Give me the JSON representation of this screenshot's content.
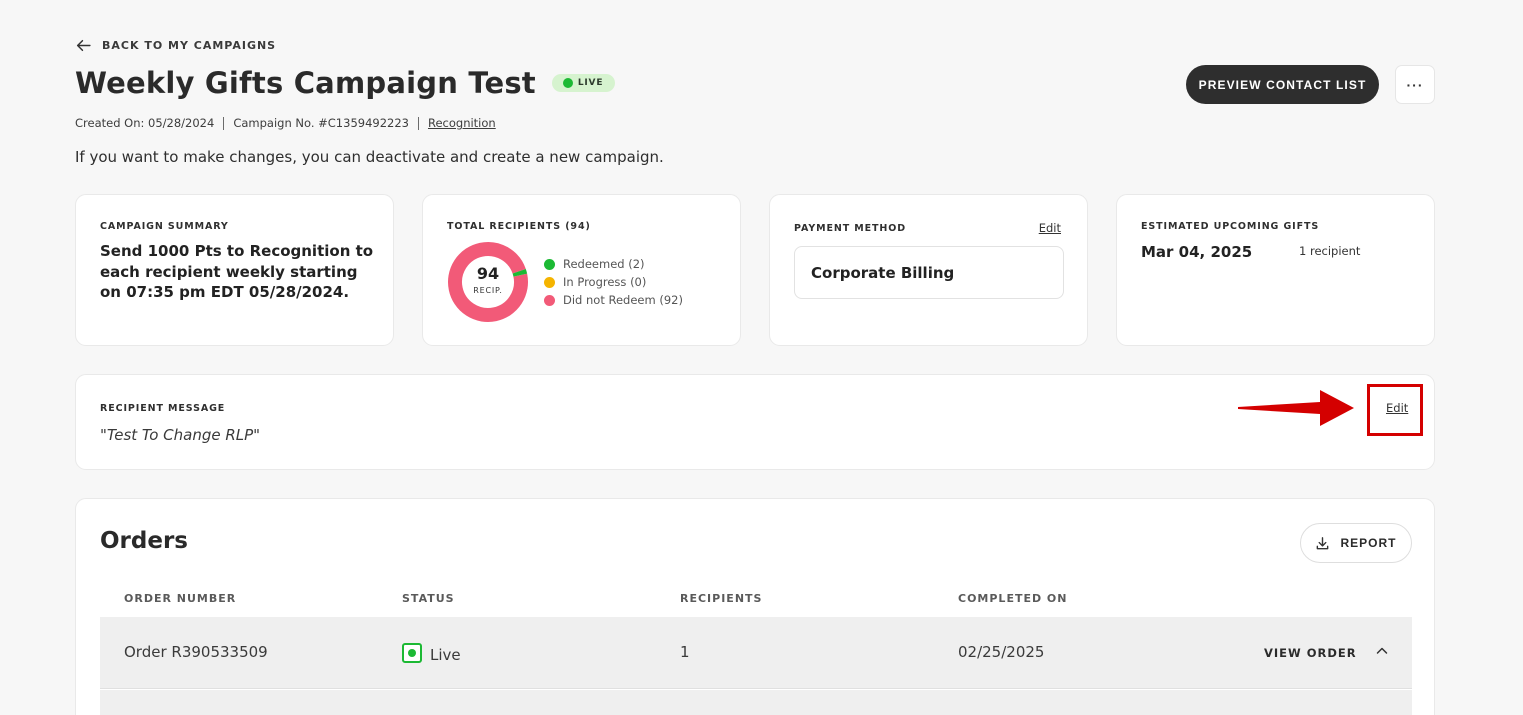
{
  "nav": {
    "back_label": "BACK TO MY CAMPAIGNS"
  },
  "header": {
    "title": "Weekly Gifts Campaign Test",
    "status_badge": "LIVE",
    "preview_button": "PREVIEW CONTACT LIST",
    "more_button": "···",
    "created_on": "Created On: 05/28/2024",
    "campaign_no": "Campaign No. #C1359492223",
    "category": "Recognition",
    "info_text": "If you want to make changes, you can deactivate and create a new campaign."
  },
  "campaign_summary": {
    "label": "CAMPAIGN SUMMARY",
    "text": "Send 1000 Pts to Recognition to each recipient weekly starting on 07:35 pm EDT 05/28/2024."
  },
  "recipients": {
    "label": "TOTAL RECIPIENTS (94)",
    "total": "94",
    "total_sub": "RECIP.",
    "legend": [
      {
        "label": "Redeemed (2)",
        "value": 2,
        "color": "#1cb934"
      },
      {
        "label": "In Progress (0)",
        "value": 0,
        "color": "#f5b400"
      },
      {
        "label": "Did not Redeem (92)",
        "value": 92,
        "color": "#f25a78"
      }
    ]
  },
  "payment": {
    "label": "PAYMENT METHOD",
    "edit_label": "Edit",
    "method": "Corporate Billing"
  },
  "upcoming": {
    "label": "ESTIMATED UPCOMING GIFTS",
    "date": "Mar 04, 2025",
    "count": "1 recipient"
  },
  "message": {
    "label": "RECIPIENT MESSAGE",
    "text": "\"Test To Change RLP\"",
    "edit_label": "Edit"
  },
  "orders": {
    "title": "Orders",
    "report_button": "REPORT",
    "columns": [
      "ORDER NUMBER",
      "STATUS",
      "RECIPIENTS",
      "COMPLETED ON"
    ],
    "rows": [
      {
        "order": "Order R390533509",
        "status": "Live",
        "recipients": "1",
        "completed": "02/25/2025",
        "action": "VIEW ORDER"
      }
    ]
  },
  "colors": {
    "accent_dark": "#2e2e2e",
    "live_green": "#1cb934",
    "annotation_red": "#d40000"
  }
}
